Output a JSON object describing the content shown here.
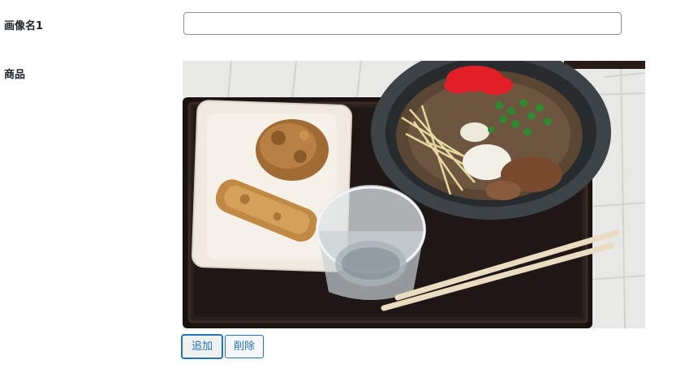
{
  "fields": {
    "image_name_label": "画像名1",
    "image_name_value": "",
    "product_label": "商品"
  },
  "actions": {
    "add_label": "追加",
    "delete_label": "削除"
  },
  "colors": {
    "accent": "#2271b1",
    "input_border": "#8c8f94"
  }
}
